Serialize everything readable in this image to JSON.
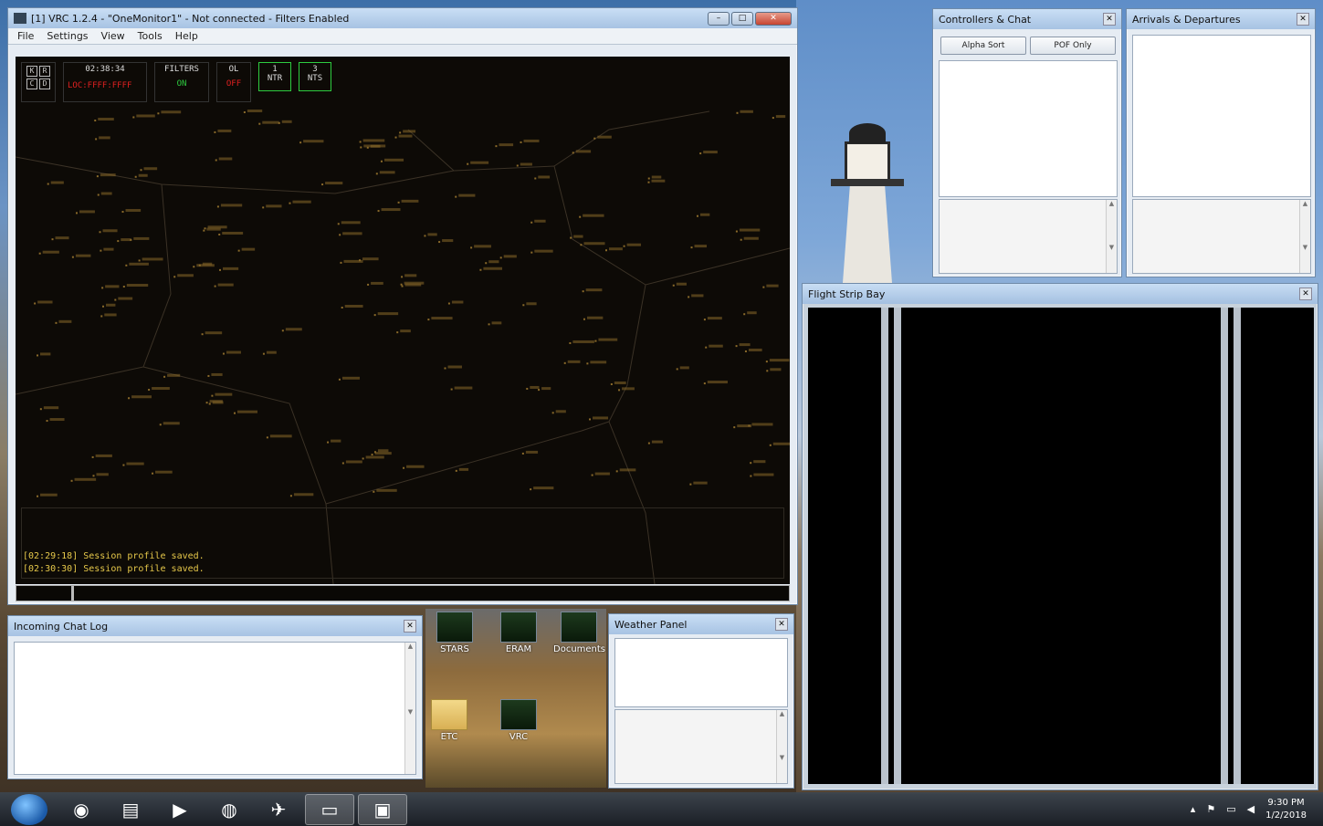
{
  "vrc": {
    "title": "[1] VRC 1.2.4 - \"OneMonitor1\" - Not connected - Filters Enabled",
    "menu": [
      "File",
      "Settings",
      "View",
      "Tools",
      "Help"
    ],
    "hud": {
      "clock": "02:38:34",
      "red_text": "LOC:FFFF:FFFF",
      "filters_label": "FILTERS",
      "filters_value": "ON",
      "ol_label": "OL",
      "ol_value": "OFF",
      "box1_top": "1",
      "box1_bottom": "NTR",
      "box2_top": "3",
      "box2_bottom": "NTS"
    },
    "messages": [
      "[02:29:18] Session profile saved.",
      "[02:30:30] Session profile saved."
    ]
  },
  "controllers": {
    "title": "Controllers & Chat",
    "alpha_sort": "Alpha Sort",
    "pof_only": "POF Only"
  },
  "arrivals": {
    "title": "Arrivals & Departures"
  },
  "flight_strip_bay": {
    "title": "Flight Strip Bay"
  },
  "chat_log": {
    "title": "Incoming Chat Log"
  },
  "weather": {
    "title": "Weather Panel"
  },
  "desktop_icons": [
    {
      "label": "STARS"
    },
    {
      "label": "ERAM"
    },
    {
      "label": "Documents"
    },
    {
      "label": "ETC"
    },
    {
      "label": "VRC"
    }
  ],
  "taskbar": {
    "time": "9:30 PM",
    "date": "1/2/2018"
  },
  "colors": {
    "radar_bg": "#0d0a06",
    "target_label": "#8a6a2a",
    "message_text": "#e6c84a",
    "hud_red": "#e02020",
    "hud_green": "#2ecc40"
  }
}
